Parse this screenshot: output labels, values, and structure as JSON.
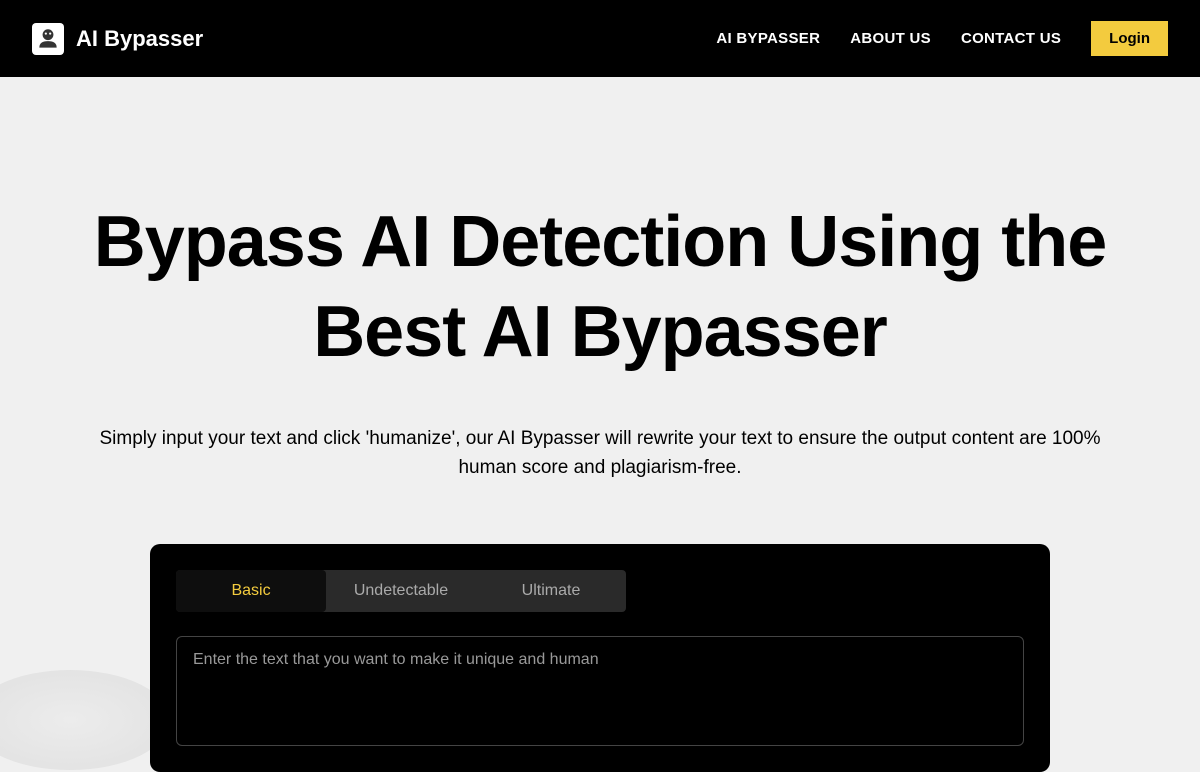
{
  "header": {
    "logo_text": "AI Bypasser",
    "nav": {
      "link1": "AI BYPASSER",
      "link2": "ABOUT US",
      "link3": "CONTACT US"
    },
    "login_label": "Login"
  },
  "hero": {
    "title": "Bypass AI Detection Using the Best AI Bypasser",
    "subtitle": "Simply input your text and click 'humanize', our AI Bypasser will rewrite your text to ensure the output content are 100% human score and plagiarism-free."
  },
  "tool": {
    "tabs": {
      "basic": "Basic",
      "undetectable": "Undetectable",
      "ultimate": "Ultimate"
    },
    "input_placeholder": "Enter the text that you want to make it unique and human"
  }
}
